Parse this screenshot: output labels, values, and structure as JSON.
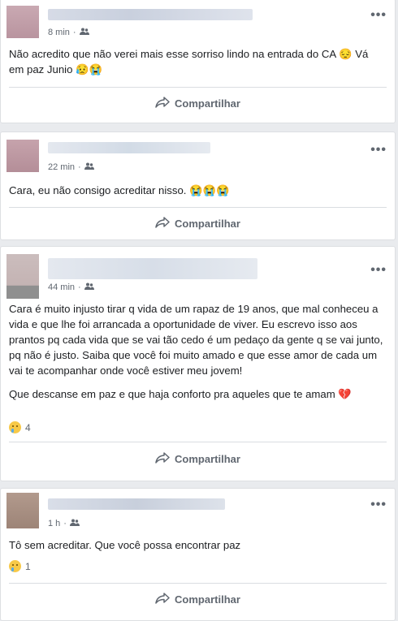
{
  "icons": {
    "audience": "friends-icon",
    "more": "ellipsis-icon",
    "share": "share-icon",
    "reaction": "sad-face-icon",
    "broken_heart": "broken-heart-icon"
  },
  "colors": {
    "meta": "#606770",
    "background": "#e9ebee",
    "card": "#ffffff"
  },
  "posts": [
    {
      "time": "8 min",
      "paragraphs": [
        "Não acredito que não verei mais esse sorriso lindo na entrada do CA 😔 Vá em paz Junio 😥😭"
      ],
      "share_label": "Compartilhar"
    },
    {
      "time": "22 min",
      "paragraphs": [
        "Cara, eu não consigo acreditar nisso. 😭😭😭"
      ],
      "share_label": "Compartilhar"
    },
    {
      "time": "44 min",
      "paragraphs": [
        "Cara é muito injusto tirar q vida de um rapaz de 19 anos, que mal conheceu a vida e que lhe foi arrancada a oportunidade de viver. Eu escrevo isso aos prantos pq cada vida que se vai tão cedo é um pedaço da gente q se vai junto, pq não é justo. Saiba que você foi muito amado e que esse amor de cada um vai te acompanhar onde você estiver meu jovem!",
        "Que descanse em paz e que haja conforto pra aqueles que te amam 💔"
      ],
      "reaction_count": "4",
      "share_label": "Compartilhar"
    },
    {
      "time": "1 h",
      "paragraphs": [
        "Tô sem acreditar. Que você possa encontrar paz"
      ],
      "reaction_count": "1",
      "share_label": "Compartilhar"
    }
  ]
}
